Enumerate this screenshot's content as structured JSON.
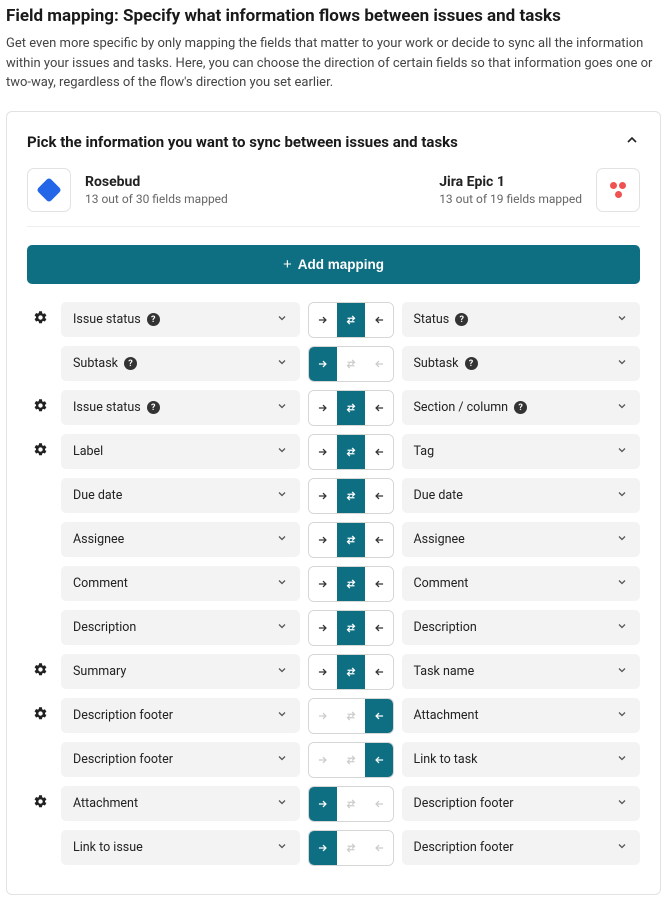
{
  "header": {
    "title": "Field mapping: Specify what information flows between issues and tasks",
    "description": "Get even more specific by only mapping the fields that matter to your work or decide to sync all the information within your issues and tasks. Here, you can choose the direction of certain fields so that information goes one or two-way, regardless of the flow's direction you set earlier."
  },
  "card": {
    "title": "Pick the information you want to sync between issues and tasks"
  },
  "source_left": {
    "name": "Rosebud",
    "sub": "13 out of 30 fields mapped"
  },
  "source_right": {
    "name": "Jira Epic 1",
    "sub": "13 out of 19 fields mapped"
  },
  "add_button": "Add mapping",
  "rows": [
    {
      "gear": true,
      "left": "Issue status",
      "left_help": true,
      "right": "Status",
      "right_help": true,
      "dir": "both"
    },
    {
      "gear": false,
      "left": "Subtask",
      "left_help": true,
      "right": "Subtask",
      "right_help": true,
      "dir": "right-only"
    },
    {
      "gear": true,
      "left": "Issue status",
      "left_help": true,
      "right": "Section / column",
      "right_help": true,
      "dir": "both"
    },
    {
      "gear": true,
      "left": "Label",
      "left_help": false,
      "right": "Tag",
      "right_help": false,
      "dir": "both"
    },
    {
      "gear": false,
      "left": "Due date",
      "left_help": false,
      "right": "Due date",
      "right_help": false,
      "dir": "both"
    },
    {
      "gear": false,
      "left": "Assignee",
      "left_help": false,
      "right": "Assignee",
      "right_help": false,
      "dir": "both"
    },
    {
      "gear": false,
      "left": "Comment",
      "left_help": false,
      "right": "Comment",
      "right_help": false,
      "dir": "both"
    },
    {
      "gear": false,
      "left": "Description",
      "left_help": false,
      "right": "Description",
      "right_help": false,
      "dir": "both"
    },
    {
      "gear": true,
      "left": "Summary",
      "left_help": false,
      "right": "Task name",
      "right_help": false,
      "dir": "both"
    },
    {
      "gear": true,
      "left": "Description footer",
      "left_help": false,
      "right": "Attachment",
      "right_help": false,
      "dir": "left-only"
    },
    {
      "gear": false,
      "left": "Description footer",
      "left_help": false,
      "right": "Link to task",
      "right_help": false,
      "dir": "left-only"
    },
    {
      "gear": true,
      "left": "Attachment",
      "left_help": false,
      "right": "Description footer",
      "right_help": false,
      "dir": "right-only"
    },
    {
      "gear": false,
      "left": "Link to issue",
      "left_help": false,
      "right": "Description footer",
      "right_help": false,
      "dir": "right-only"
    }
  ]
}
